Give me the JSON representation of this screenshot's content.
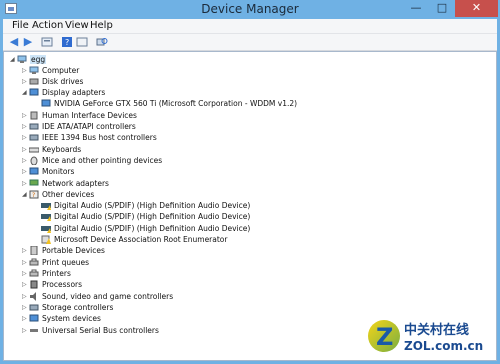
{
  "window": {
    "title": "Device Manager",
    "minimize": "—",
    "maximize": "□",
    "close": "✕"
  },
  "menu": [
    "File",
    "Action",
    "View",
    "Help"
  ],
  "toolbar": [
    "back-icon",
    "forward-icon",
    "properties-icon",
    "help-icon",
    "scan-icon"
  ],
  "tree": {
    "root": "egg",
    "items": [
      {
        "label": "Computer",
        "icon": "computer-icon",
        "expanded": false
      },
      {
        "label": "Disk drives",
        "icon": "disk-icon",
        "expanded": false
      },
      {
        "label": "Display adapters",
        "icon": "display-icon",
        "expanded": true,
        "children": [
          {
            "label": "NVIDIA GeForce GTX 560 Ti (Microsoft Corporation - WDDM v1.2)",
            "icon": "display-icon"
          }
        ]
      },
      {
        "label": "Human Interface Devices",
        "icon": "hid-icon",
        "expanded": false
      },
      {
        "label": "IDE ATA/ATAPI controllers",
        "icon": "ide-icon",
        "expanded": false
      },
      {
        "label": "IEEE 1394 Bus host controllers",
        "icon": "ieee-icon",
        "expanded": false
      },
      {
        "label": "Keyboards",
        "icon": "keyboard-icon",
        "expanded": false
      },
      {
        "label": "Mice and other pointing devices",
        "icon": "mouse-icon",
        "expanded": false
      },
      {
        "label": "Monitors",
        "icon": "monitor-icon",
        "expanded": false
      },
      {
        "label": "Network adapters",
        "icon": "network-icon",
        "expanded": false
      },
      {
        "label": "Other devices",
        "icon": "other-icon",
        "expanded": true,
        "children": [
          {
            "label": "Digital Audio (S/PDIF) (High Definition Audio Device)",
            "icon": "audio-warning-icon"
          },
          {
            "label": "Digital Audio (S/PDIF) (High Definition Audio Device)",
            "icon": "audio-warning-icon"
          },
          {
            "label": "Digital Audio (S/PDIF) (High Definition Audio Device)",
            "icon": "audio-warning-icon"
          },
          {
            "label": "Microsoft Device Association Root Enumerator",
            "icon": "warning-device-icon"
          }
        ]
      },
      {
        "label": "Portable Devices",
        "icon": "portable-icon",
        "expanded": false
      },
      {
        "label": "Print queues",
        "icon": "printer-icon",
        "expanded": false
      },
      {
        "label": "Printers",
        "icon": "printer-icon",
        "expanded": false
      },
      {
        "label": "Processors",
        "icon": "processor-icon",
        "expanded": false
      },
      {
        "label": "Sound, video and game controllers",
        "icon": "sound-icon",
        "expanded": false
      },
      {
        "label": "Storage controllers",
        "icon": "storage-icon",
        "expanded": false
      },
      {
        "label": "System devices",
        "icon": "system-icon",
        "expanded": false
      },
      {
        "label": "Universal Serial Bus controllers",
        "icon": "usb-icon",
        "expanded": false
      }
    ]
  },
  "watermark": {
    "brand": "中关村在线",
    "site": "ZOL.com.cn"
  }
}
